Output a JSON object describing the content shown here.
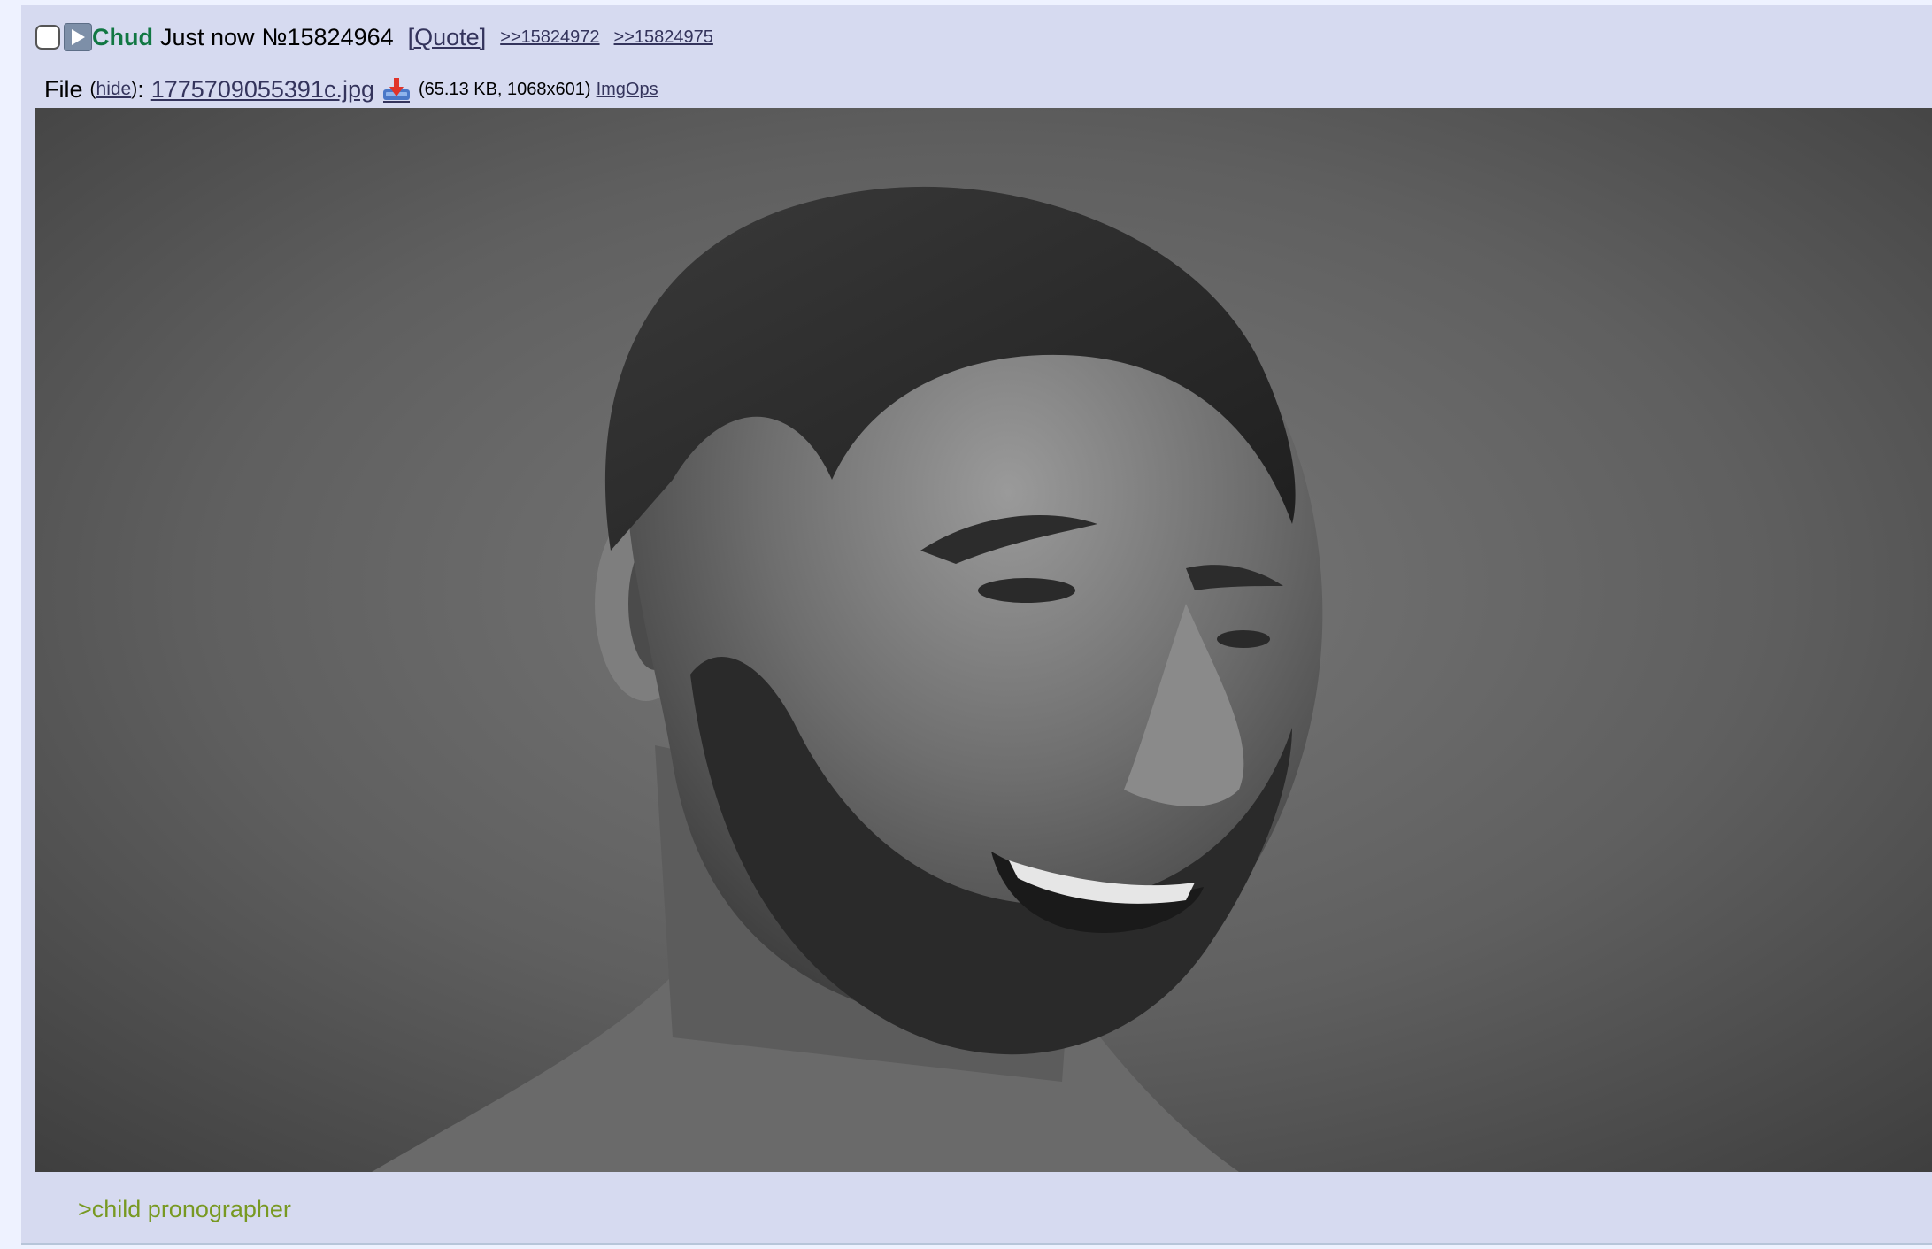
{
  "post": {
    "name": "Chud",
    "date": "Just now",
    "post_number": "№15824964",
    "quote_label": "[Quote]",
    "backlinks": [
      ">>15824972",
      ">>15824975"
    ],
    "file": {
      "label": "File",
      "open_paren": "(",
      "hide_label": "hide",
      "close_paren": ")",
      "colon": ":",
      "filename": "1775709055391c.jpg",
      "meta": "(65.13 KB, 1068x601)",
      "imgops_label": "ImgOps"
    },
    "message": ">child pronographer"
  },
  "icons": {
    "checkbox": "checkbox-icon",
    "expand": "play-triangle-icon",
    "download": "download-icon"
  },
  "colors": {
    "post_background": "#d6daf0",
    "page_background": "#eef2ff",
    "name_color": "#117743",
    "link_color": "#34345c",
    "greentext_color": "#789922"
  }
}
